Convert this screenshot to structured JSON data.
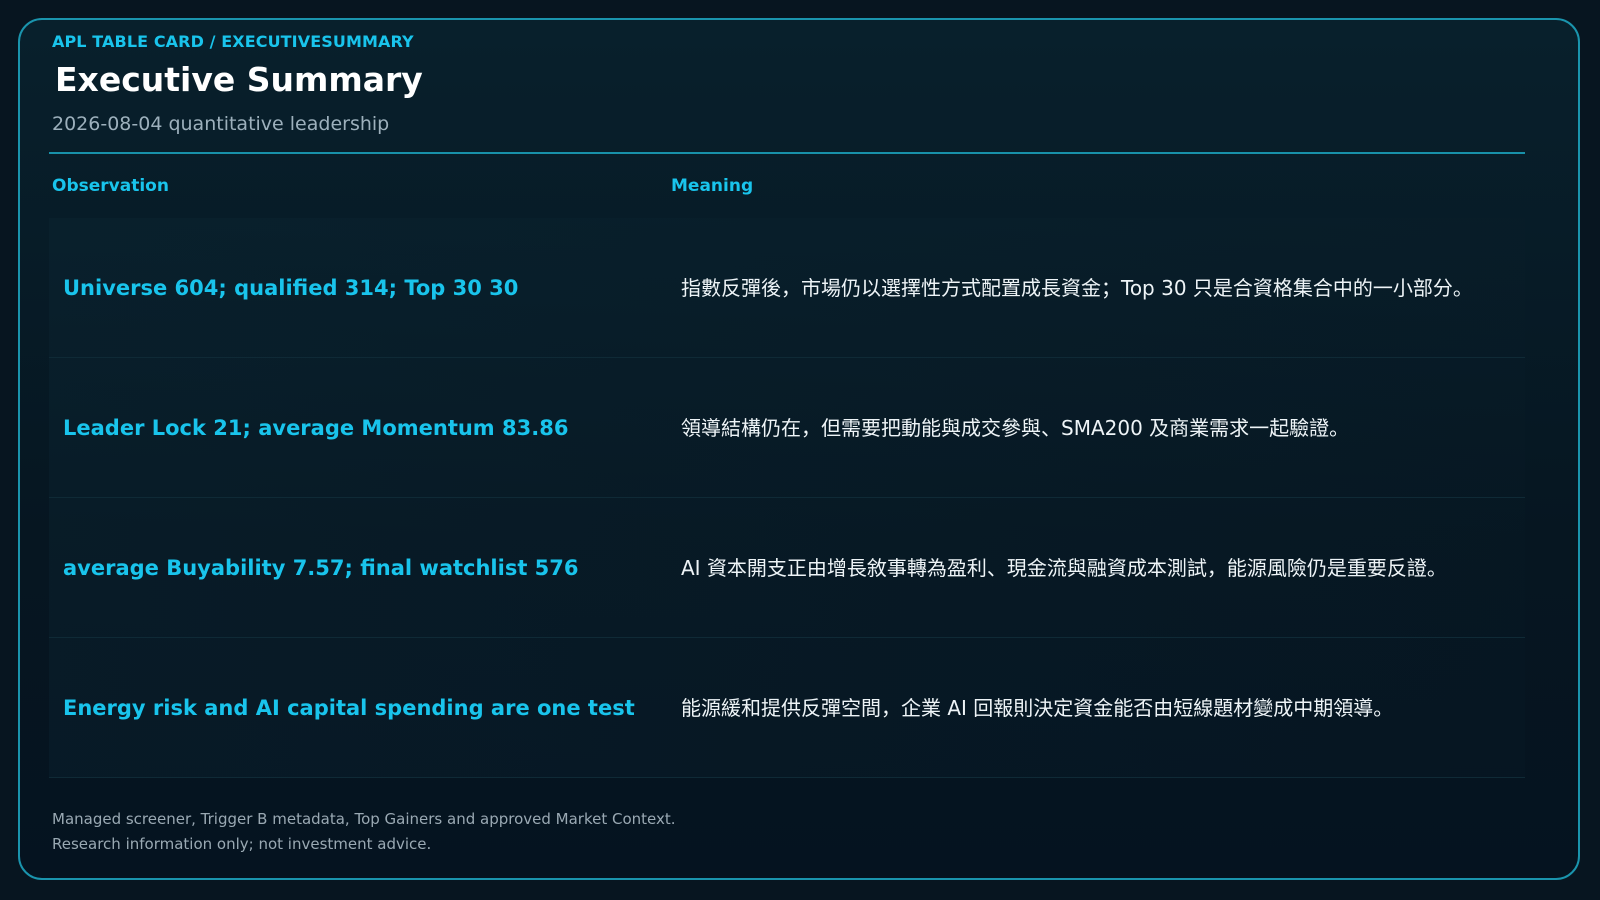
{
  "card": {
    "kicker": "APL TABLE CARD / EXECUTIVESUMMARY",
    "title": "Executive Summary",
    "subtitle": "2026-08-04 quantitative leadership"
  },
  "table": {
    "headers": {
      "observation": "Observation",
      "meaning": "Meaning"
    },
    "rows": [
      {
        "observation": "Universe 604; qualified 314; Top 30 30",
        "meaning": "指數反彈後，市場仍以選擇性方式配置成長資金；Top 30 只是合資格集合中的一小部分。"
      },
      {
        "observation": "Leader Lock 21; average Momentum 83.86",
        "meaning": "領導結構仍在，但需要把動能與成交參與、SMA200 及商業需求一起驗證。"
      },
      {
        "observation": "average Buyability 7.57; final watchlist 576",
        "meaning": "AI 資本開支正由增長敘事轉為盈利、現金流與融資成本測試，能源風險仍是重要反證。"
      },
      {
        "observation": "Energy risk and AI capital spending are one test",
        "meaning": "能源緩和提供反彈空間，企業 AI 回報則決定資金能否由短線題材變成中期領導。"
      }
    ]
  },
  "footer": {
    "line1": "Managed screener, Trigger B metadata, Top Gainers and approved Market Context.",
    "line2": "Research information only; not investment advice."
  },
  "colors": {
    "accent": "#19c4ec",
    "border": "#1a94ad",
    "background": "#071520",
    "text": "#eef4f7",
    "muted": "#9db0bc"
  }
}
